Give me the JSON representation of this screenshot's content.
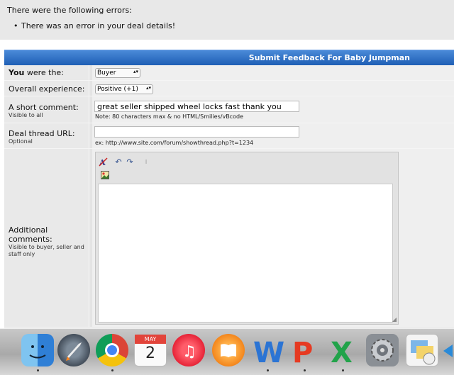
{
  "errors": {
    "heading": "There were the following errors:",
    "items": [
      "There was an error in your deal details!"
    ]
  },
  "form": {
    "title": "Submit Feedback For Baby Jumpman",
    "you_were": {
      "label_bold": "You",
      "label_rest": " were the:",
      "value": "Buyer",
      "options": [
        "Buyer"
      ]
    },
    "experience": {
      "label": "Overall experience:",
      "value": "Positive (+1)",
      "options": [
        "Positive (+1)"
      ]
    },
    "short_comment": {
      "label": "A short comment:",
      "sublabel": "Visible to all",
      "value": "great seller shipped wheel locks fast thank you",
      "note": "Note: 80 characters max & no HTML/Smilies/vBcode"
    },
    "deal_url": {
      "label": "Deal thread URL:",
      "sublabel": "Optional",
      "value": "",
      "note": "ex: http://www.site.com/forum/showthread.php?t=1234"
    },
    "additional": {
      "label": "Additional comments:",
      "sublabel": "Visible to buyer, seller and staff only",
      "value": ""
    }
  },
  "dock": {
    "apps": [
      "finder",
      "launchpad",
      "chrome",
      "calendar",
      "itunes",
      "ibooks",
      "word",
      "powerpoint",
      "excel",
      "system-preferences",
      "preview"
    ],
    "calendar_month": "MAY",
    "calendar_day": "2"
  },
  "colors": {
    "titlebar": "#1f5fb5",
    "panel": "#e4e4e4",
    "error_bg": "#e8e8e8"
  }
}
